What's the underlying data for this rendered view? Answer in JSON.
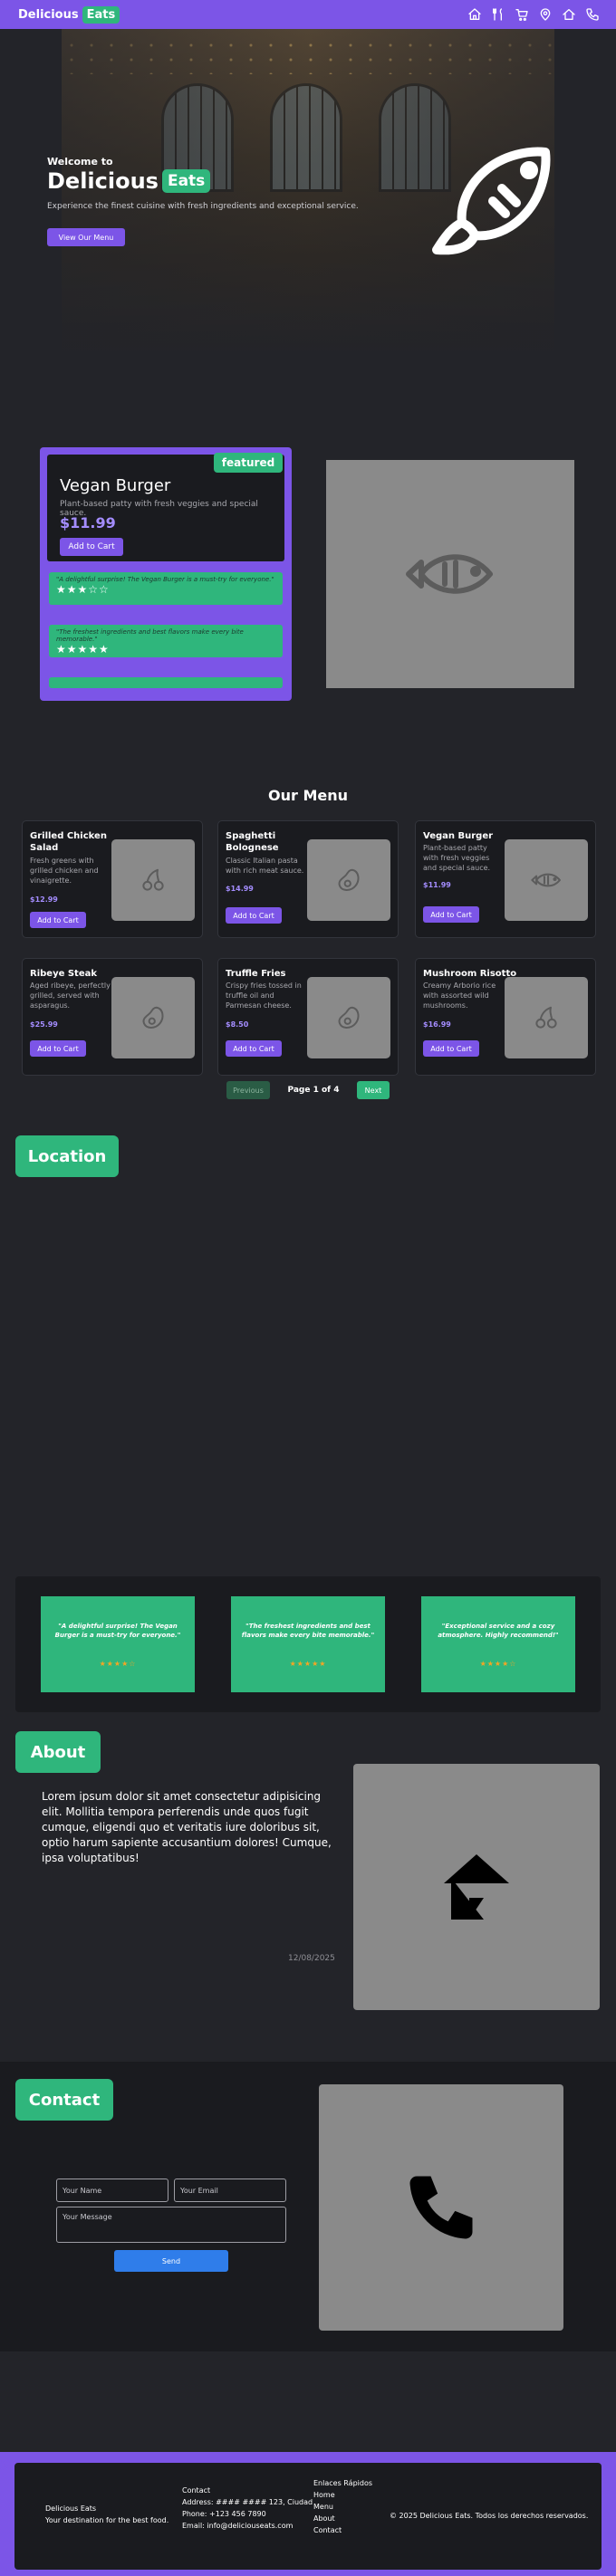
{
  "navbar": {
    "brand": "Delicious",
    "brand_accent": "Eats",
    "icons": [
      "home-icon",
      "utensils-icon",
      "cart-icon",
      "map-pin-icon",
      "home-outline-icon",
      "phone-icon"
    ]
  },
  "hero": {
    "welcome": "Welcome to",
    "title": "Delicious",
    "title_accent": "Eats",
    "subtitle": "Experience the finest cuisine with fresh ingredients and exceptional service.",
    "button": "View Our Menu",
    "icon": "fish-icon"
  },
  "featured": {
    "badge": "featured",
    "name": "Vegan Burger",
    "description": "Plant-based patty with fresh veggies and special sauce.",
    "price": "$11.99",
    "button": "Add to Cart",
    "reviews": [
      {
        "text": "\"A delightful surprise! The Vegan Burger is a must-try for everyone.\"",
        "stars": "★★★☆☆"
      },
      {
        "text": "\"The freshest ingredients and best flavors make every bite memorable.\"",
        "stars": "★★★★★"
      },
      {
        "text": "",
        "stars": ""
      }
    ],
    "image_icon": "fish-icon"
  },
  "menu": {
    "title": "Our Menu",
    "items": [
      {
        "name": "Grilled Chicken Salad",
        "description": "Fresh greens with grilled chicken and vinaigrette.",
        "price": "$12.99",
        "button": "Add to Cart",
        "icon": "cherry-icon"
      },
      {
        "name": "Spaghetti Bolognese",
        "description": "Classic Italian pasta with rich meat sauce.",
        "price": "$14.99",
        "button": "Add to Cart",
        "icon": "avocado-icon"
      },
      {
        "name": "Vegan Burger",
        "description": "Plant-based patty with fresh veggies and special sauce.",
        "price": "$11.99",
        "button": "Add to Cart",
        "icon": "fish-icon"
      },
      {
        "name": "Ribeye Steak",
        "description": "Aged ribeye, perfectly grilled, served with asparagus.",
        "price": "$25.99",
        "button": "Add to Cart",
        "icon": "avocado-icon"
      },
      {
        "name": "Truffle Fries",
        "description": "Crispy fries tossed in truffle oil and Parmesan cheese.",
        "price": "$8.50",
        "button": "Add to Cart",
        "icon": "avocado-icon"
      },
      {
        "name": "Mushroom Risotto",
        "description": "Creamy Arborio rice with assorted wild mushrooms.",
        "price": "$16.99",
        "button": "Add to Cart",
        "icon": "cherry-icon"
      }
    ],
    "pagination": {
      "prev": "Previous",
      "info": "Page 1 of 4",
      "next": "Next"
    }
  },
  "location": {
    "title": "Location"
  },
  "testimonials": [
    {
      "text": "\"A delightful surprise! The Vegan Burger is a must-try for everyone.\"",
      "stars": "★★★★☆"
    },
    {
      "text": "\"The freshest ingredients and best flavors make every bite memorable.\"",
      "stars": "★★★★★"
    },
    {
      "text": "\"Exceptional service and a cozy atmosphere. Highly recommend!\"",
      "stars": "★★★★☆"
    }
  ],
  "about": {
    "title": "About",
    "text": "Lorem ipsum dolor sit amet consectetur adipisicing elit. Mollitia tempora perferendis unde quos fugit cumque, eligendi quo et veritatis iure doloribus sit, optio harum sapiente accusantium dolores! Cumque, ipsa voluptatibus!",
    "date": "12/08/2025",
    "image_icon": "house-alert-icon"
  },
  "contact": {
    "title": "Contact",
    "name_placeholder": "Your Name",
    "email_placeholder": "Your Email",
    "message_placeholder": "Your Message",
    "send": "Send",
    "image_icon": "phone-icon"
  },
  "footer": {
    "brand": "Delicious Eats",
    "tagline": "Your destination for the best food.",
    "contact_title": "Contact",
    "address": "Address: #### #### 123, Ciudad",
    "phone": "Phone: +123 456 7890",
    "email": "Email: info@deliciouseats.com",
    "links_title": "Enlaces Rápidos",
    "links": [
      "Home",
      "Menu",
      "About",
      "Contact"
    ],
    "copyright": "© 2025 Delicious Eats. Todos los derechos reservados."
  },
  "colors": {
    "primary": "#7c55e7",
    "accent": "#2fb67c",
    "background": "#232429",
    "card": "#1a1b1f",
    "send_button": "#2f7dea"
  }
}
